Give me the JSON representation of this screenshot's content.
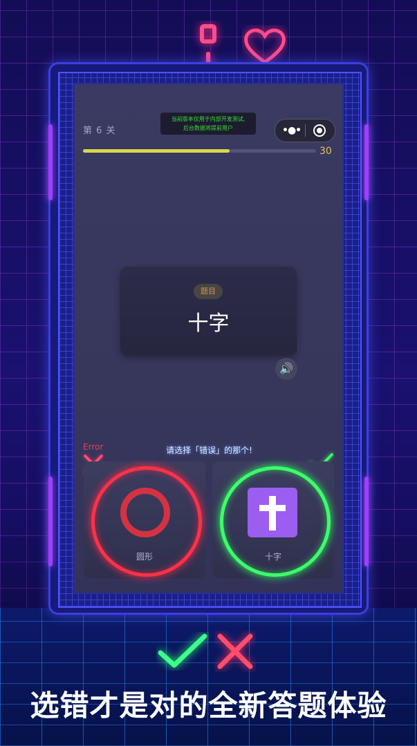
{
  "level": "第 6 关",
  "dev_notice": [
    "当前版本仅用于内部开发测试,",
    "后台数据将提前用户"
  ],
  "capsule": {
    "more_icon": "more-dots-icon",
    "close_icon": "record-close-icon"
  },
  "progress": {
    "fraction": 0.63,
    "timer": "30",
    "color": "#d9d84a"
  },
  "question": {
    "chip": "题目",
    "text": "十字"
  },
  "prompt": "请选择「错误」的那个!",
  "error_tag": "Error",
  "options": [
    {
      "label": "圆形",
      "icon": "circle-icon",
      "state": "wrong"
    },
    {
      "label": "十字",
      "icon": "cross-icon",
      "state": "correct"
    }
  ],
  "headline": "选错才是对的全新答题体验",
  "colors": {
    "red": "#ff3148",
    "green": "#3dff6a",
    "purple": "#9b5ef0",
    "accent_yellow": "#e3c24c"
  }
}
